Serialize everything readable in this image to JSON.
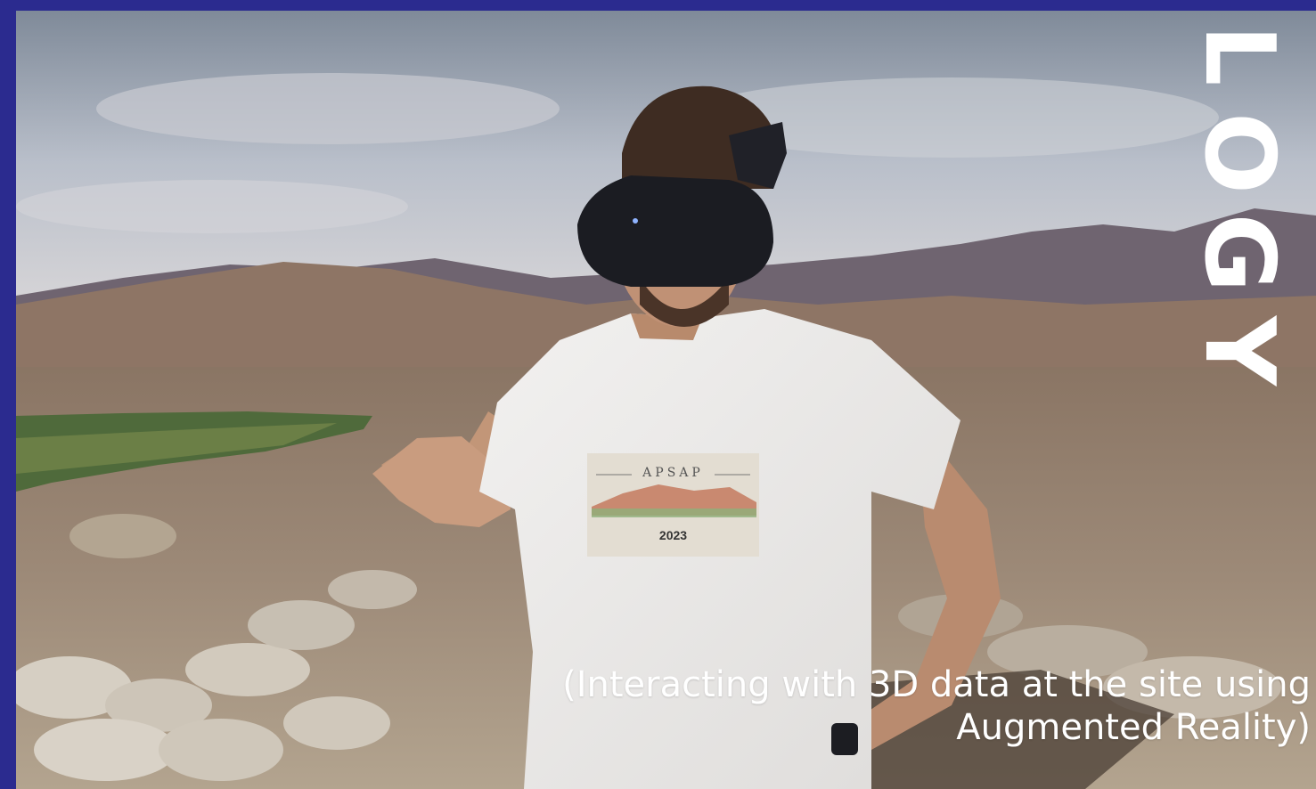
{
  "vertical_text": [
    "L",
    "O",
    "G",
    "Y"
  ],
  "caption": {
    "line1": "(Interacting with 3D data at the site using",
    "line2": "Augmented Reality)"
  },
  "shirt": {
    "title": "APSAP",
    "year": "2023"
  },
  "colors": {
    "frame": "#2b2b8f",
    "text": "#ffffff"
  }
}
